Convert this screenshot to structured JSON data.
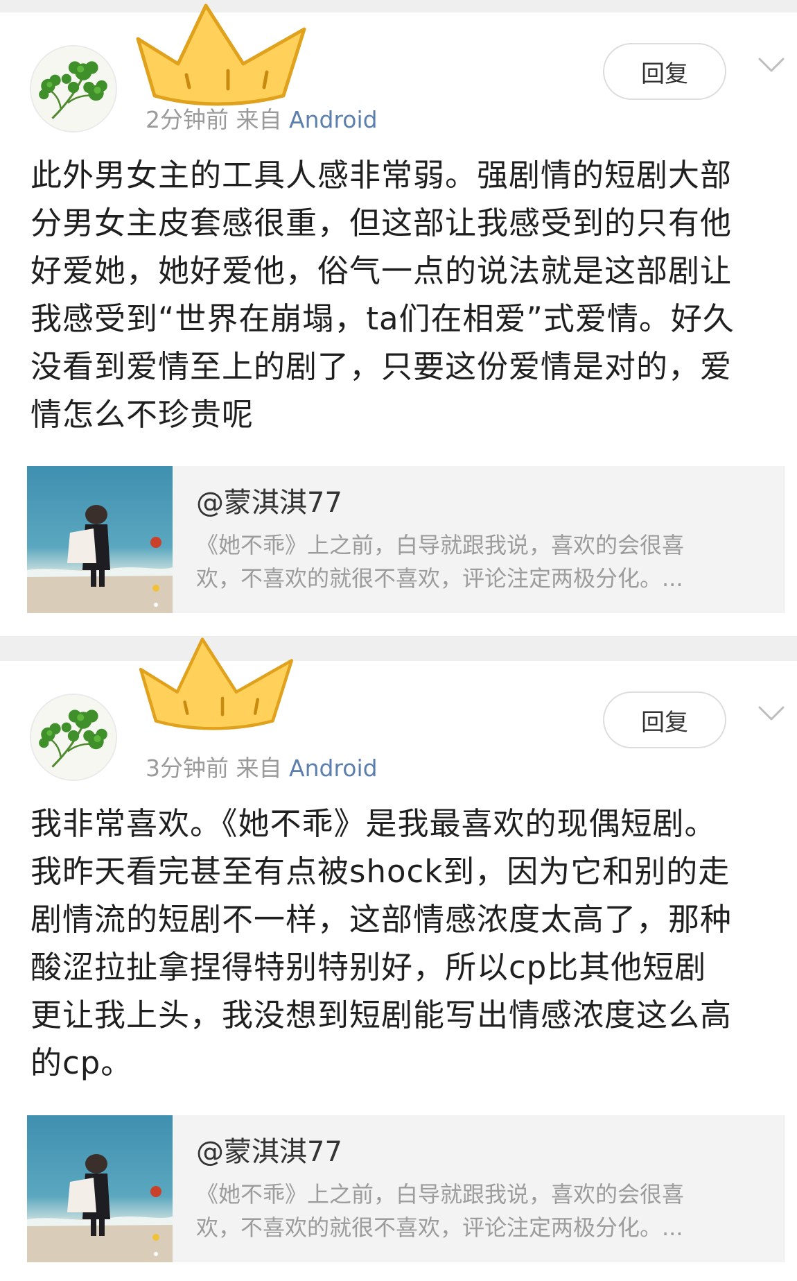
{
  "posts": [
    {
      "meta": {
        "time": "2分钟前",
        "from_prefix": "来自",
        "source": "Android"
      },
      "reply_label": "回复",
      "body": "此外男女主的工具人感非常弱。强剧情的短剧大部\n分男女主皮套感很重，但这部让我感受到的只有他\n好爱她，她好爱他，俗气一点的说法就是这部剧让\n我感受到“世界在崩塌，ta们在相爱”式爱情。好久\n没看到爱情至上的剧了，只要这份爱情是对的，爱\n情怎么不珍贵呢",
      "quote": {
        "user": "@蒙淇淇77",
        "snippet": "《她不乖》上之前，白导就跟我说，喜欢的会很喜\n欢，不喜欢的就很不喜欢，评论注定两极分化。..."
      }
    },
    {
      "meta": {
        "time": "3分钟前",
        "from_prefix": "来自",
        "source": "Android"
      },
      "reply_label": "回复",
      "body": "我非常喜欢。《她不乖》是我最喜欢的现偶短剧。\n我昨天看完甚至有点被shock到，因为它和别的走\n剧情流的短剧不一样，这部情感浓度太高了，那种\n酸涩拉扯拿捏得特别特别好，所以cp比其他短剧\n更让我上头，我没想到短剧能写出情感浓度这么高\n的cp。",
      "quote": {
        "user": "@蒙淇淇77",
        "snippet": "《她不乖》上之前，白导就跟我说，喜欢的会很喜\n欢，不喜欢的就很不喜欢，评论注定两极分化。..."
      }
    }
  ],
  "icons": {
    "avatar": "cilantro-avatar",
    "crown": "crown-sticker",
    "chevron": "chevron-down-icon"
  },
  "colors": {
    "source_link": "#5d7fae",
    "meta_text": "#9a9a9a",
    "crown_fill": "#ffd15a",
    "crown_stroke": "#e0a21c",
    "card_bg": "#f3f3f3",
    "separator": "#efefef"
  }
}
